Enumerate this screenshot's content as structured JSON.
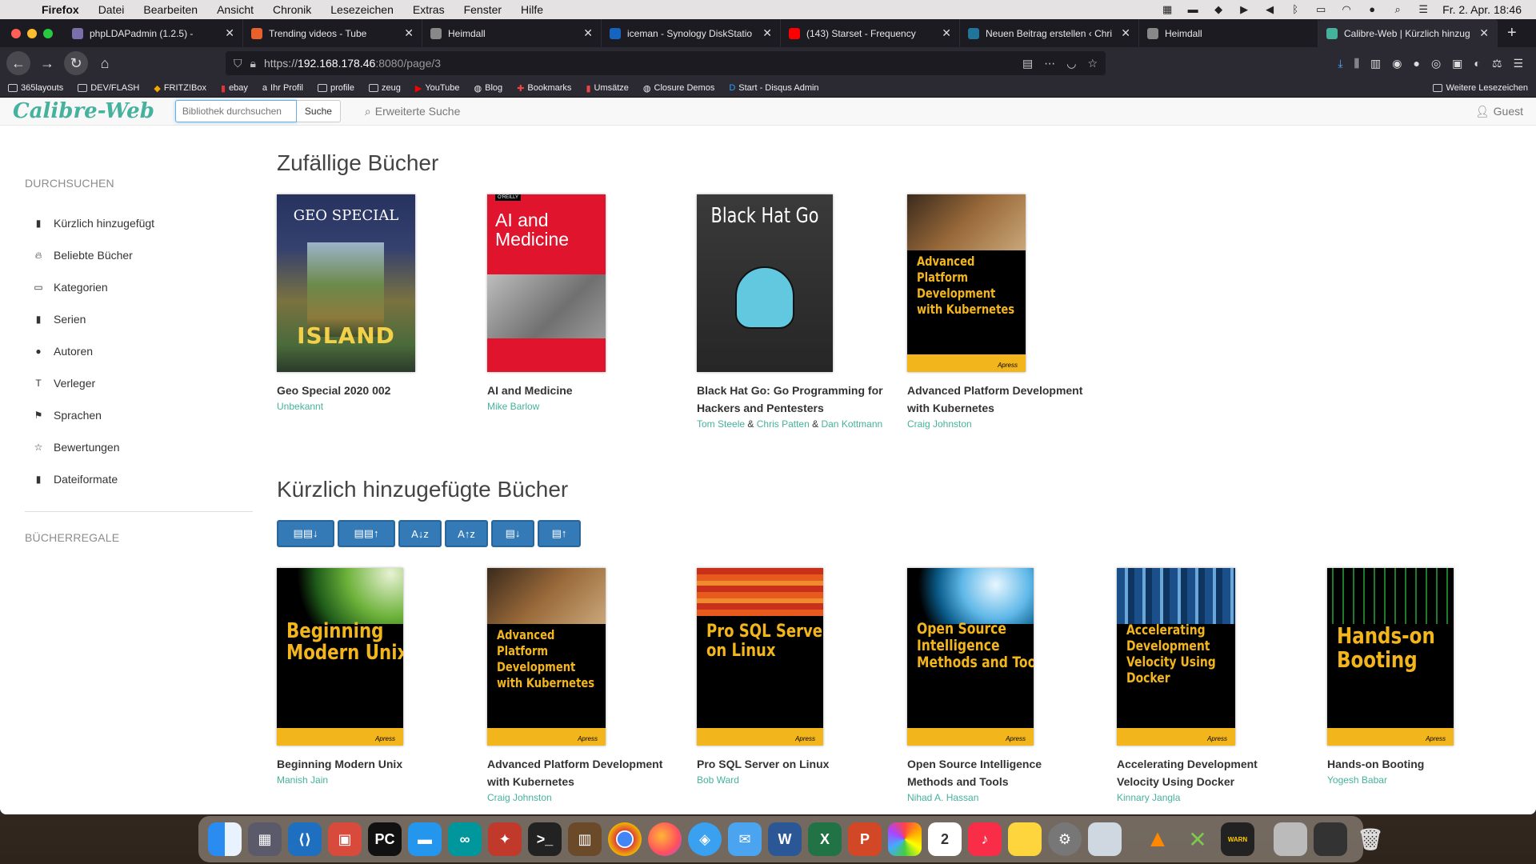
{
  "menubar": {
    "app": "Firefox",
    "items": [
      "Datei",
      "Bearbeiten",
      "Ansicht",
      "Chronik",
      "Lesezeichen",
      "Extras",
      "Fenster",
      "Hilfe"
    ],
    "datetime": "Fr. 2. Apr.  18:46"
  },
  "tabs": [
    {
      "title": "phpLDAPadmin (1.2.5) -",
      "color": "#7a6fa8"
    },
    {
      "title": "Trending videos - Tube",
      "color": "#e8602c"
    },
    {
      "title": "Heimdall",
      "color": "#888888"
    },
    {
      "title": "iceman - Synology DiskStatio",
      "color": "#1565c0"
    },
    {
      "title": "(143) Starset - Frequency",
      "color": "#ff0000"
    },
    {
      "title": "Neuen Beitrag erstellen ‹ Chri",
      "color": "#21759b"
    },
    {
      "title": "Heimdall",
      "color": "#888888"
    },
    {
      "title": "Calibre-Web | Kürzlich hinzug",
      "color": "#45b29d"
    }
  ],
  "url": {
    "prefix": "https://",
    "host": "192.168.178.46",
    "rest": ":8080/page/3"
  },
  "bookmarks": [
    "365layouts",
    "DEV/FLASH",
    "FRITZ!Box",
    "ebay",
    "Ihr Profil",
    "profile",
    "zeug",
    "YouTube",
    "Blog",
    "Bookmarks",
    "Umsätze",
    "Closure Demos",
    "Start - Disqus Admin"
  ],
  "bookmarks_other": "Weitere Lesezeichen",
  "calibre": {
    "logo": "Calibre-Web",
    "search_placeholder": "Bibliothek durchsuchen",
    "search_button": "Suche",
    "advanced_search": "Erweiterte Suche",
    "user": "Guest"
  },
  "sidebar": {
    "heading_browse": "DURCHSUCHEN",
    "items": [
      {
        "label": "Kürzlich hinzugefügt",
        "icon": "book-icon"
      },
      {
        "label": "Beliebte Bücher",
        "icon": "fire-icon"
      },
      {
        "label": "Kategorien",
        "icon": "inbox-icon"
      },
      {
        "label": "Serien",
        "icon": "bookmark-icon"
      },
      {
        "label": "Autoren",
        "icon": "user-icon"
      },
      {
        "label": "Verleger",
        "icon": "text-size-icon"
      },
      {
        "label": "Sprachen",
        "icon": "flag-icon"
      },
      {
        "label": "Bewertungen",
        "icon": "star-icon"
      },
      {
        "label": "Dateiformate",
        "icon": "file-icon"
      }
    ],
    "heading_shelves": "BÜCHERREGALE"
  },
  "random_books": {
    "title": "Zufällige Bücher",
    "books": [
      {
        "title": "Geo Special 2020 002",
        "authors": [
          "Unbekannt"
        ],
        "cover_text": "GEO SPECIAL",
        "cover_big": "ISLAND"
      },
      {
        "title": "AI and Medicine",
        "authors": [
          "Mike Barlow"
        ],
        "cover_text": "AI and Medicine"
      },
      {
        "title": "Black Hat Go: Go Programming for Hackers and Pentesters",
        "authors": [
          "Tom Steele",
          "Chris Patten",
          "Dan Kottmann"
        ],
        "cover_text": "Black Hat Go"
      },
      {
        "title": "Advanced Platform Development with Kubernetes",
        "authors": [
          "Craig Johnston"
        ],
        "cover_text": "Advanced Platform Development with Kubernetes"
      }
    ]
  },
  "recent_books": {
    "title": "Kürzlich hinzugefügte Bücher",
    "books": [
      {
        "title": "Beginning Modern Unix",
        "authors": [
          "Manish Jain"
        ],
        "cover_text": "Beginning Modern Unix"
      },
      {
        "title": "Advanced Platform Development with Kubernetes",
        "authors": [
          "Craig Johnston"
        ],
        "cover_text": "Advanced Platform Development with Kubernetes"
      },
      {
        "title": "Pro SQL Server on Linux",
        "authors": [
          "Bob Ward"
        ],
        "cover_text": "Pro SQL Server on Linux"
      },
      {
        "title": "Open Source Intelligence Methods and Tools",
        "authors": [
          "Nihad A. Hassan"
        ],
        "cover_text": "Open Source Intelligence Methods and Tools"
      },
      {
        "title": "Accelerating Development Velocity Using Docker",
        "authors": [
          "Kinnary Jangla"
        ],
        "cover_text": "Accelerating Development Velocity Using Docker"
      },
      {
        "title": "Hands-on Booting",
        "authors": [
          "Yogesh Babar"
        ],
        "cover_text": "Hands-on Booting"
      }
    ]
  },
  "sort_buttons": [
    {
      "label": "▤▤↓",
      "name": "sort-newest-button"
    },
    {
      "label": "▤▤↑",
      "name": "sort-oldest-button"
    },
    {
      "label": "A↓z",
      "name": "sort-title-asc-button"
    },
    {
      "label": "A↑z",
      "name": "sort-title-desc-button"
    },
    {
      "label": "▤↓",
      "name": "sort-pubdate-newest-button"
    },
    {
      "label": "▤↑",
      "name": "sort-pubdate-oldest-button"
    }
  ],
  "colors": {
    "accent": "#45b29d",
    "primary": "#337ab7",
    "apress_yellow": "#f3b51c"
  }
}
